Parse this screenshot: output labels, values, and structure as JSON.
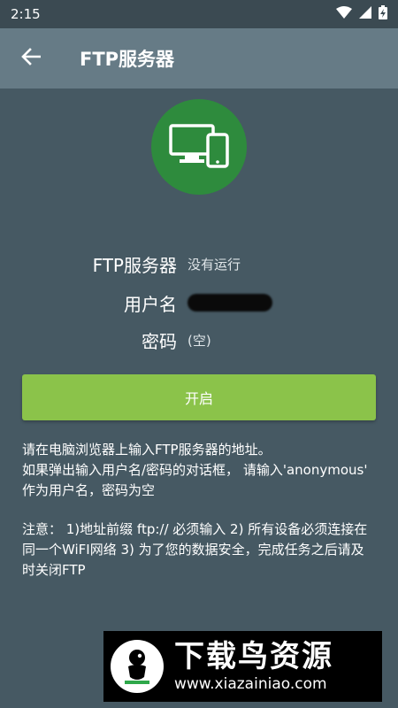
{
  "status_bar": {
    "time": "2:15",
    "icons": [
      "wifi-icon",
      "signal-icon",
      "battery-icon"
    ]
  },
  "app_bar": {
    "back_icon": "back-arrow-icon",
    "title": "FTP服务器"
  },
  "hero": {
    "icon": "desktop-phone-icon",
    "color": "#2e8b3d"
  },
  "info": {
    "server_label": "FTP服务器",
    "server_status": "没有运行",
    "username_label": "用户名",
    "password_label": "密码",
    "password_value": "(空)"
  },
  "start_button": {
    "label": "开启",
    "color": "#8bc34a"
  },
  "description": {
    "line1": "请在电脑浏览器上输入FTP服务器的地址。",
    "line2": "如果弹出输入用户名/密码的对话框， 请输入'anonymous' 作为用户名，密码为空",
    "note": "注意： 1)地址前缀 ftp:// 必须输入 2) 所有设备必须连接在同一个WiFI网络 3) 为了您的数据安全，完成任务之后请及时关闭FTP"
  },
  "watermark": {
    "title": "下载鸟资源",
    "url": "www.xiazainiao.com"
  }
}
